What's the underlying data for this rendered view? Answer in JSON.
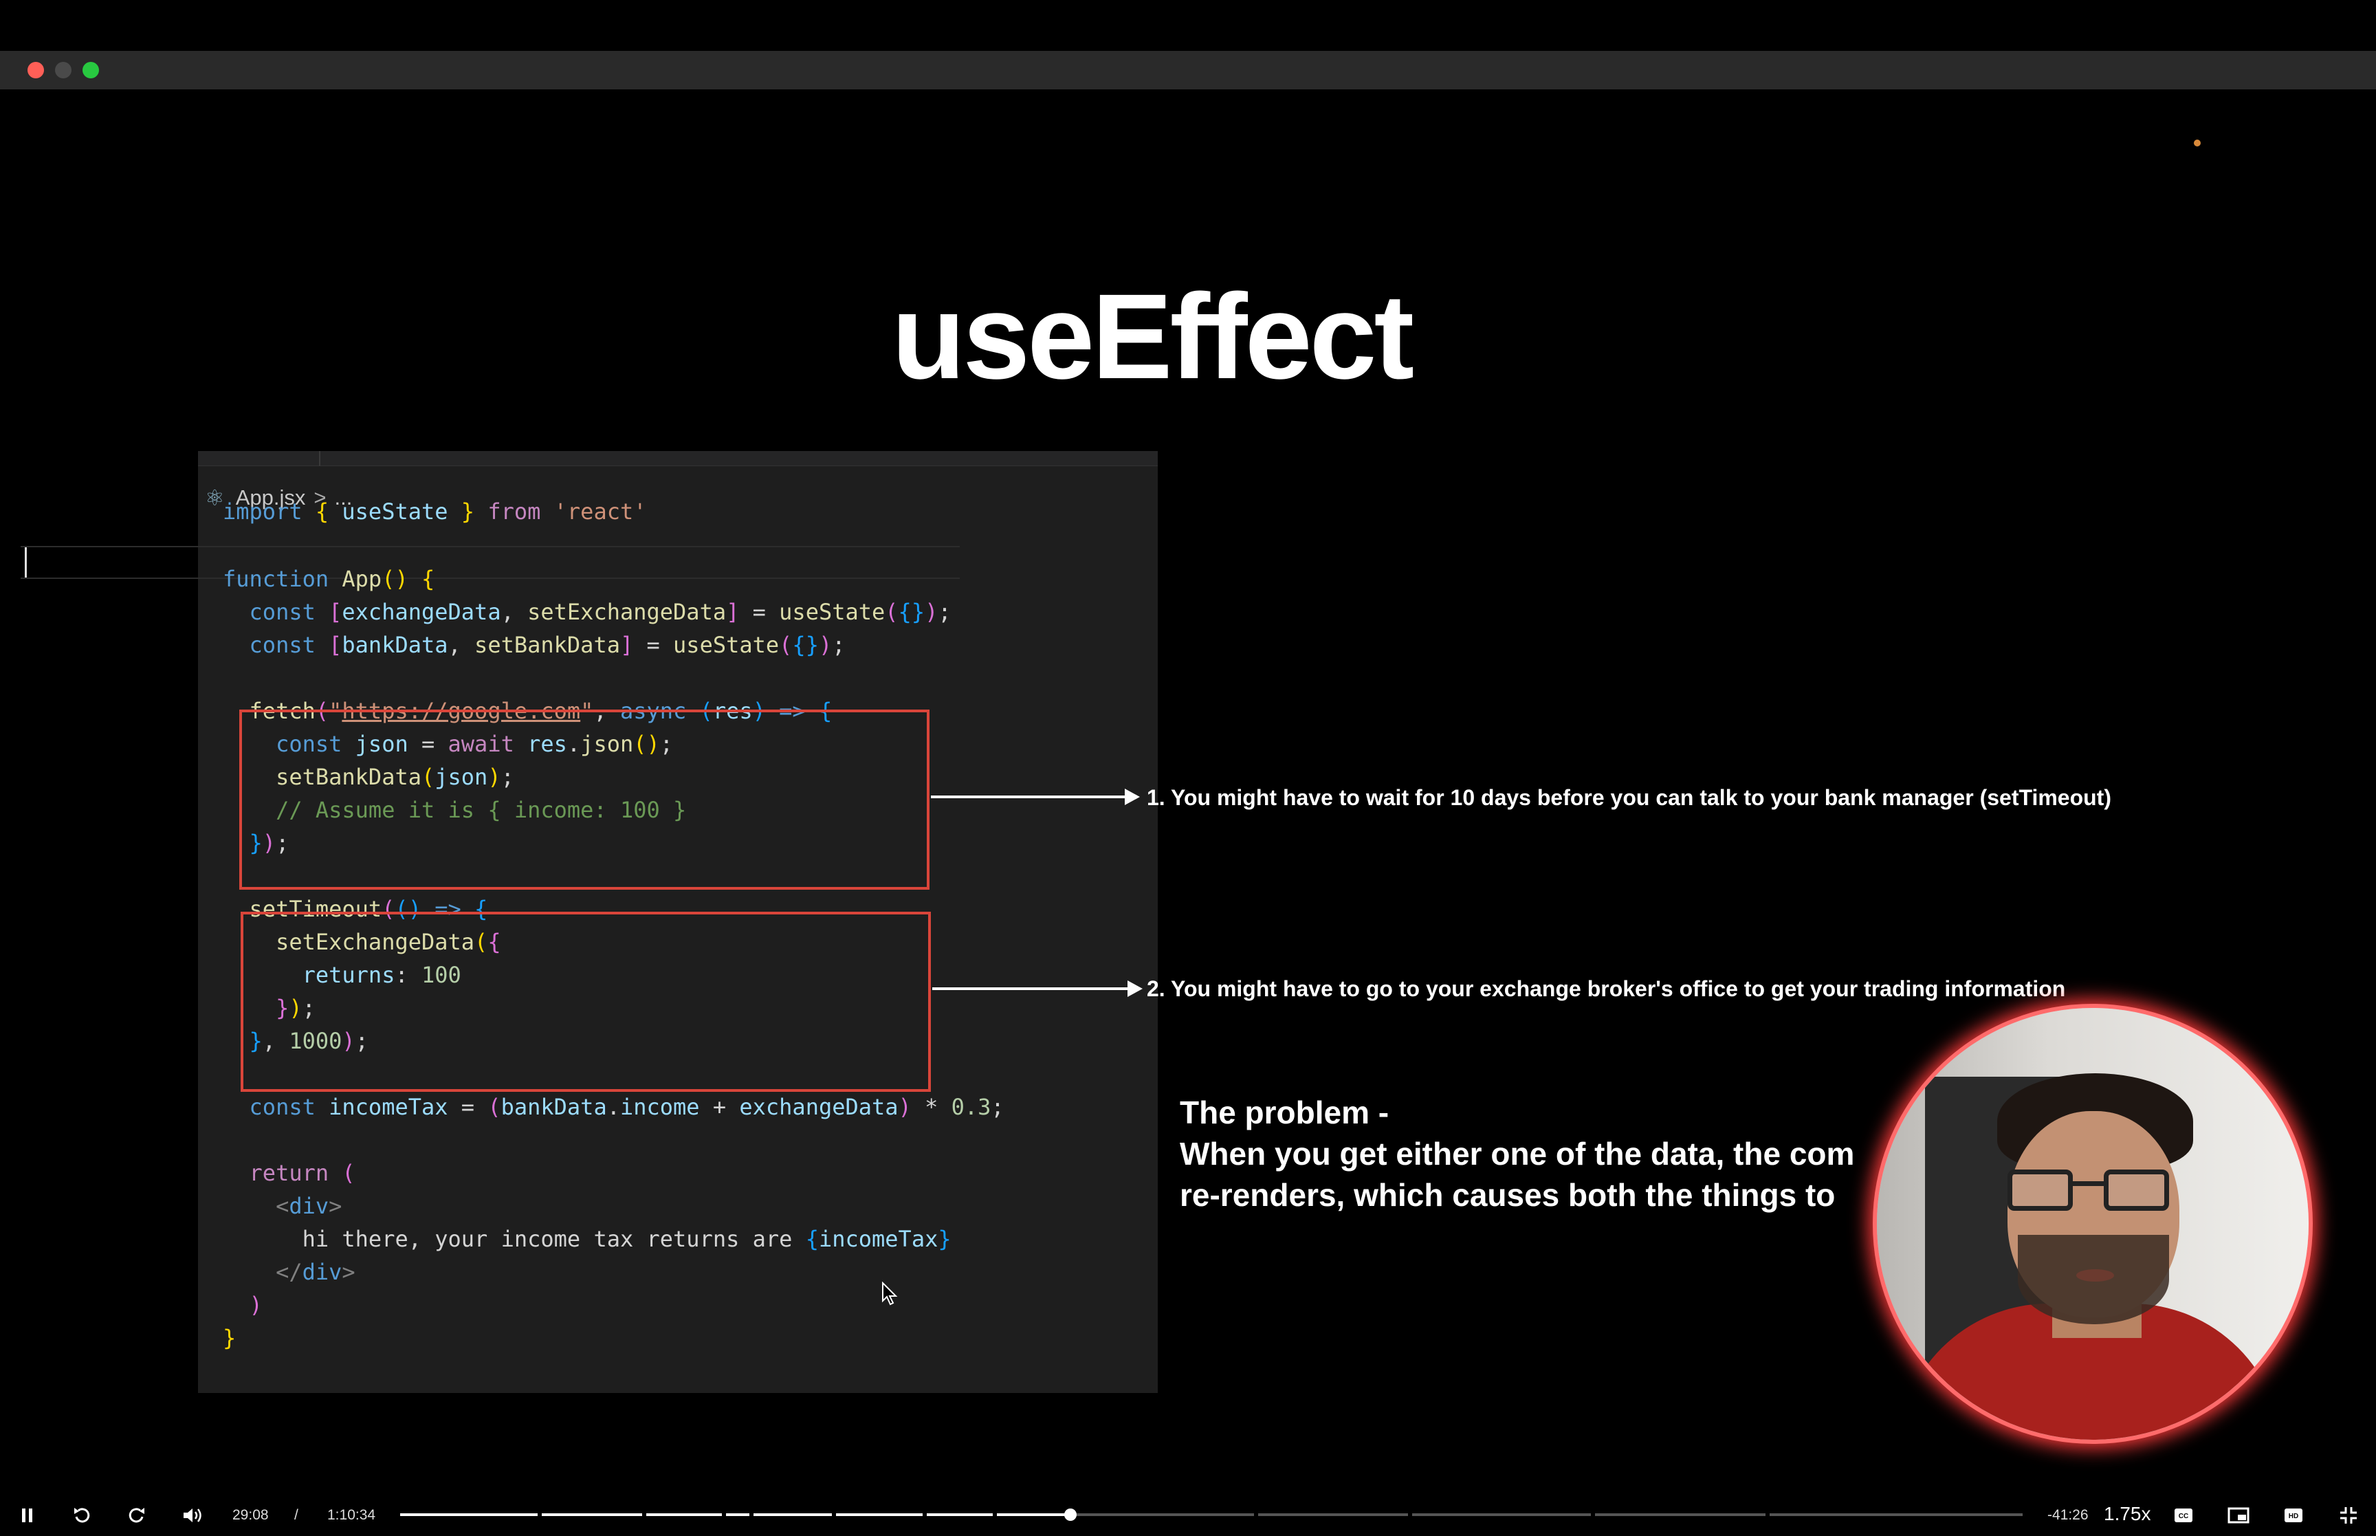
{
  "slide": {
    "title": "useEffect"
  },
  "editor": {
    "breadcrumb_file": "App.jsx",
    "breadcrumb_more": "...",
    "react_icon": "react-icon",
    "chevron_icon": "chevron-right-icon"
  },
  "code_lines": [
    [
      [
        "kw",
        "import"
      ],
      [
        "txt",
        " "
      ],
      [
        "br1",
        "{"
      ],
      [
        "txt",
        " "
      ],
      [
        "var",
        "useState"
      ],
      [
        "txt",
        " "
      ],
      [
        "br1",
        "}"
      ],
      [
        "txt",
        " "
      ],
      [
        "ctl",
        "from"
      ],
      [
        "txt",
        " "
      ],
      [
        "str",
        "'react'"
      ]
    ],
    [],
    [
      [
        "kw",
        "function"
      ],
      [
        "txt",
        " "
      ],
      [
        "fn",
        "App"
      ],
      [
        "br1",
        "()"
      ],
      [
        "txt",
        " "
      ],
      [
        "br1",
        "{"
      ]
    ],
    [
      [
        "txt",
        "  "
      ],
      [
        "kw",
        "const"
      ],
      [
        "txt",
        " "
      ],
      [
        "br2",
        "["
      ],
      [
        "var",
        "exchangeData"
      ],
      [
        "txt",
        ", "
      ],
      [
        "fn",
        "setExchangeData"
      ],
      [
        "br2",
        "]"
      ],
      [
        "txt",
        " = "
      ],
      [
        "fn",
        "useState"
      ],
      [
        "br2",
        "("
      ],
      [
        "br3",
        "{}"
      ],
      [
        "br2",
        ")"
      ],
      [
        "txt",
        ";"
      ]
    ],
    [
      [
        "txt",
        "  "
      ],
      [
        "kw",
        "const"
      ],
      [
        "txt",
        " "
      ],
      [
        "br2",
        "["
      ],
      [
        "var",
        "bankData"
      ],
      [
        "txt",
        ", "
      ],
      [
        "fn",
        "setBankData"
      ],
      [
        "br2",
        "]"
      ],
      [
        "txt",
        " = "
      ],
      [
        "fn",
        "useState"
      ],
      [
        "br2",
        "("
      ],
      [
        "br3",
        "{}"
      ],
      [
        "br2",
        ")"
      ],
      [
        "txt",
        ";"
      ]
    ],
    [],
    [
      [
        "txt",
        "  "
      ],
      [
        "fn",
        "fetch"
      ],
      [
        "br2",
        "("
      ],
      [
        "str",
        "\""
      ],
      [
        "url",
        "https://google.com"
      ],
      [
        "str",
        "\""
      ],
      [
        "txt",
        ", "
      ],
      [
        "kw",
        "async"
      ],
      [
        "txt",
        " "
      ],
      [
        "br3",
        "("
      ],
      [
        "var",
        "res"
      ],
      [
        "br3",
        ")"
      ],
      [
        "txt",
        " "
      ],
      [
        "kw",
        "=>"
      ],
      [
        "txt",
        " "
      ],
      [
        "br3",
        "{"
      ]
    ],
    [
      [
        "txt",
        "    "
      ],
      [
        "kw",
        "const"
      ],
      [
        "txt",
        " "
      ],
      [
        "var",
        "json"
      ],
      [
        "txt",
        " = "
      ],
      [
        "ctl",
        "await"
      ],
      [
        "txt",
        " "
      ],
      [
        "var",
        "res"
      ],
      [
        "txt",
        "."
      ],
      [
        "fn",
        "json"
      ],
      [
        "br1",
        "()"
      ],
      [
        "txt",
        ";"
      ]
    ],
    [
      [
        "txt",
        "    "
      ],
      [
        "fn",
        "setBankData"
      ],
      [
        "br1",
        "("
      ],
      [
        "var",
        "json"
      ],
      [
        "br1",
        ")"
      ],
      [
        "txt",
        ";"
      ]
    ],
    [
      [
        "txt",
        "    "
      ],
      [
        "cmt",
        "// Assume it is { income: 100 }"
      ]
    ],
    [
      [
        "txt",
        "  "
      ],
      [
        "br3",
        "}"
      ],
      [
        "br2",
        ")"
      ],
      [
        "txt",
        ";"
      ]
    ],
    [],
    [
      [
        "txt",
        "  "
      ],
      [
        "fn",
        "setTimeout"
      ],
      [
        "br2",
        "("
      ],
      [
        "br3",
        "()"
      ],
      [
        "txt",
        " "
      ],
      [
        "kw",
        "=>"
      ],
      [
        "txt",
        " "
      ],
      [
        "br3",
        "{"
      ]
    ],
    [
      [
        "txt",
        "    "
      ],
      [
        "fn",
        "setExchangeData"
      ],
      [
        "br1",
        "("
      ],
      [
        "br2",
        "{"
      ]
    ],
    [
      [
        "txt",
        "      "
      ],
      [
        "var",
        "returns"
      ],
      [
        "txt",
        ": "
      ],
      [
        "num",
        "100"
      ]
    ],
    [
      [
        "txt",
        "    "
      ],
      [
        "br2",
        "}"
      ],
      [
        "br1",
        ")"
      ],
      [
        "txt",
        ";"
      ]
    ],
    [
      [
        "txt",
        "  "
      ],
      [
        "br3",
        "}"
      ],
      [
        "txt",
        ", "
      ],
      [
        "num",
        "1000"
      ],
      [
        "br2",
        ")"
      ],
      [
        "txt",
        ";"
      ]
    ],
    [],
    [
      [
        "txt",
        "  "
      ],
      [
        "kw",
        "const"
      ],
      [
        "txt",
        " "
      ],
      [
        "var",
        "incomeTax"
      ],
      [
        "txt",
        " = "
      ],
      [
        "br2",
        "("
      ],
      [
        "var",
        "bankData"
      ],
      [
        "txt",
        "."
      ],
      [
        "var",
        "income"
      ],
      [
        "txt",
        " + "
      ],
      [
        "var",
        "exchangeData"
      ],
      [
        "br2",
        ")"
      ],
      [
        "txt",
        " * "
      ],
      [
        "num",
        "0.3"
      ],
      [
        "txt",
        ";"
      ]
    ],
    [],
    [
      [
        "txt",
        "  "
      ],
      [
        "ctl",
        "return"
      ],
      [
        "txt",
        " "
      ],
      [
        "br2",
        "("
      ]
    ],
    [
      [
        "txt",
        "    "
      ],
      [
        "tag",
        "<"
      ],
      [
        "kw",
        "div"
      ],
      [
        "tag",
        ">"
      ]
    ],
    [
      [
        "txt",
        "      "
      ],
      [
        "txt",
        "hi there, your income tax returns are "
      ],
      [
        "br3",
        "{"
      ],
      [
        "var",
        "incomeTax"
      ],
      [
        "br3",
        "}"
      ]
    ],
    [
      [
        "txt",
        "    "
      ],
      [
        "tag",
        "</"
      ],
      [
        "kw",
        "div"
      ],
      [
        "tag",
        ">"
      ]
    ],
    [
      [
        "txt",
        "  "
      ],
      [
        "br2",
        ")"
      ]
    ],
    [
      [
        "br1",
        "}"
      ]
    ]
  ],
  "annotations": {
    "note1": "1. You might have to wait for 10 days before you can talk to your bank manager (setTimeout)",
    "note2": "2. You might have to go to your exchange broker's office to get your trading information",
    "problem": "The problem -\nWhen you get either one of the data, the com\nre-renders, which causes both the things to"
  },
  "player": {
    "current_time": "29:08",
    "separator": "/",
    "duration": "1:10:34",
    "remaining": "-41:26",
    "speed": "1.75x",
    "progress_fraction": 0.413,
    "icons": {
      "play_pause": "pause-icon",
      "rewind": "rewind-icon",
      "forward": "forward-icon",
      "volume": "volume-icon",
      "captions": "captions-icon",
      "pip": "picture-in-picture-icon",
      "hd": "hd-icon",
      "fullscreen": "exit-fullscreen-icon"
    }
  }
}
